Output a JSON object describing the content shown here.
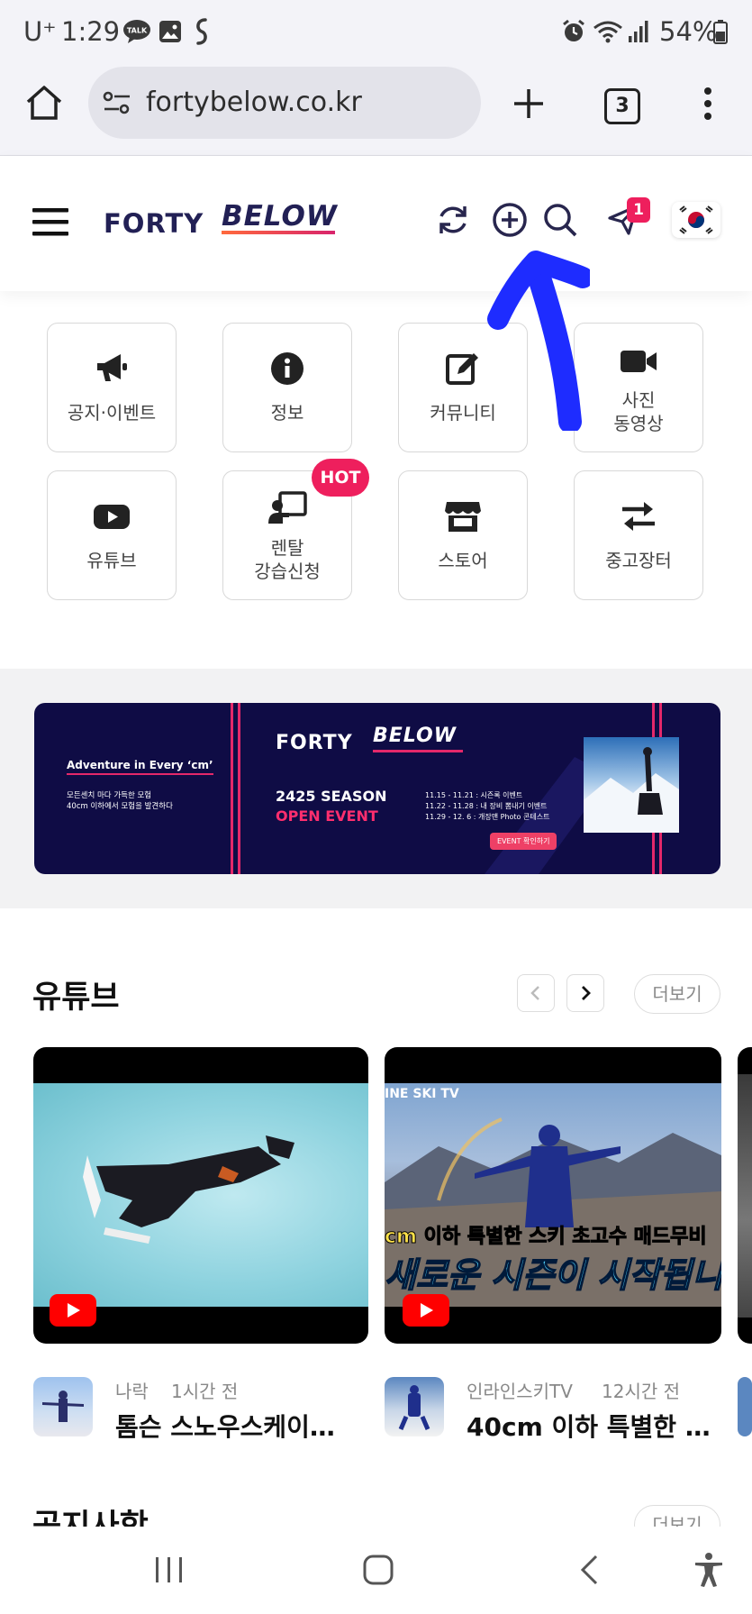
{
  "status_bar": {
    "carrier": "U⁺",
    "time": "1:29",
    "talk_badge": "TALK",
    "battery": "54%"
  },
  "browser": {
    "url": "fortybelow.co.kr",
    "tab_count": "3"
  },
  "site_header": {
    "logo_part1": "FORTY",
    "logo_part2": "BELOW",
    "notification_count": "1"
  },
  "menu": [
    {
      "label": "공지·이벤트",
      "icon": "megaphone-icon"
    },
    {
      "label": "정보",
      "icon": "info-icon"
    },
    {
      "label": "커뮤니티",
      "icon": "edit-icon"
    },
    {
      "label": "사진\n동영상",
      "icon": "video-camera-icon"
    },
    {
      "label": "유튜브",
      "icon": "youtube-icon"
    },
    {
      "label": "렌탈\n강습신청",
      "icon": "instructor-icon"
    },
    {
      "label": "스토어",
      "icon": "store-icon"
    },
    {
      "label": "중고장터",
      "icon": "exchange-icon"
    }
  ],
  "hot_badge": "HOT",
  "banner": {
    "headline": "Adventure in Every ‘cm’",
    "sub1": "모든센치 마다 가득한 모험",
    "sub2": "40cm 이하에서 모험을 발견하다",
    "logo1": "FORTY",
    "logo2": "BELOW",
    "season": "2425 SEASON",
    "event": "OPEN EVENT",
    "schedule1": "11.15 - 11.21 : 시즌록 이벤트",
    "schedule2": "11.22 - 11.28 : 내 장비 뽐내기 이벤트",
    "schedule3": "11.29 - 12. 6 : 개장맨 Photo 콘테스트",
    "cta": "EVENT 확인하기"
  },
  "youtube": {
    "title": "유튜브",
    "more": "더보기",
    "videos": [
      {
        "channel": "나락",
        "time": "1시간 전",
        "title": "톰슨 스노우스케이트..."
      },
      {
        "channel": "인라인스키TV",
        "time": "12시간 전",
        "title": "40cm 이하 특별한 스...",
        "overlay_channel": "INE SKI TV",
        "overlay_line1": "cm 이하 특별한 스키 초고수 매드무비",
        "overlay_line2": "새로운 시즌이 시작됩니다"
      }
    ]
  },
  "notice": {
    "title": "공지사항",
    "more": "더보기"
  },
  "colors": {
    "accent_pink": "#ee1f5d",
    "logo_navy": "#222055",
    "annotation_blue": "#1e2cff",
    "banner_navy": "#0f0c45"
  }
}
